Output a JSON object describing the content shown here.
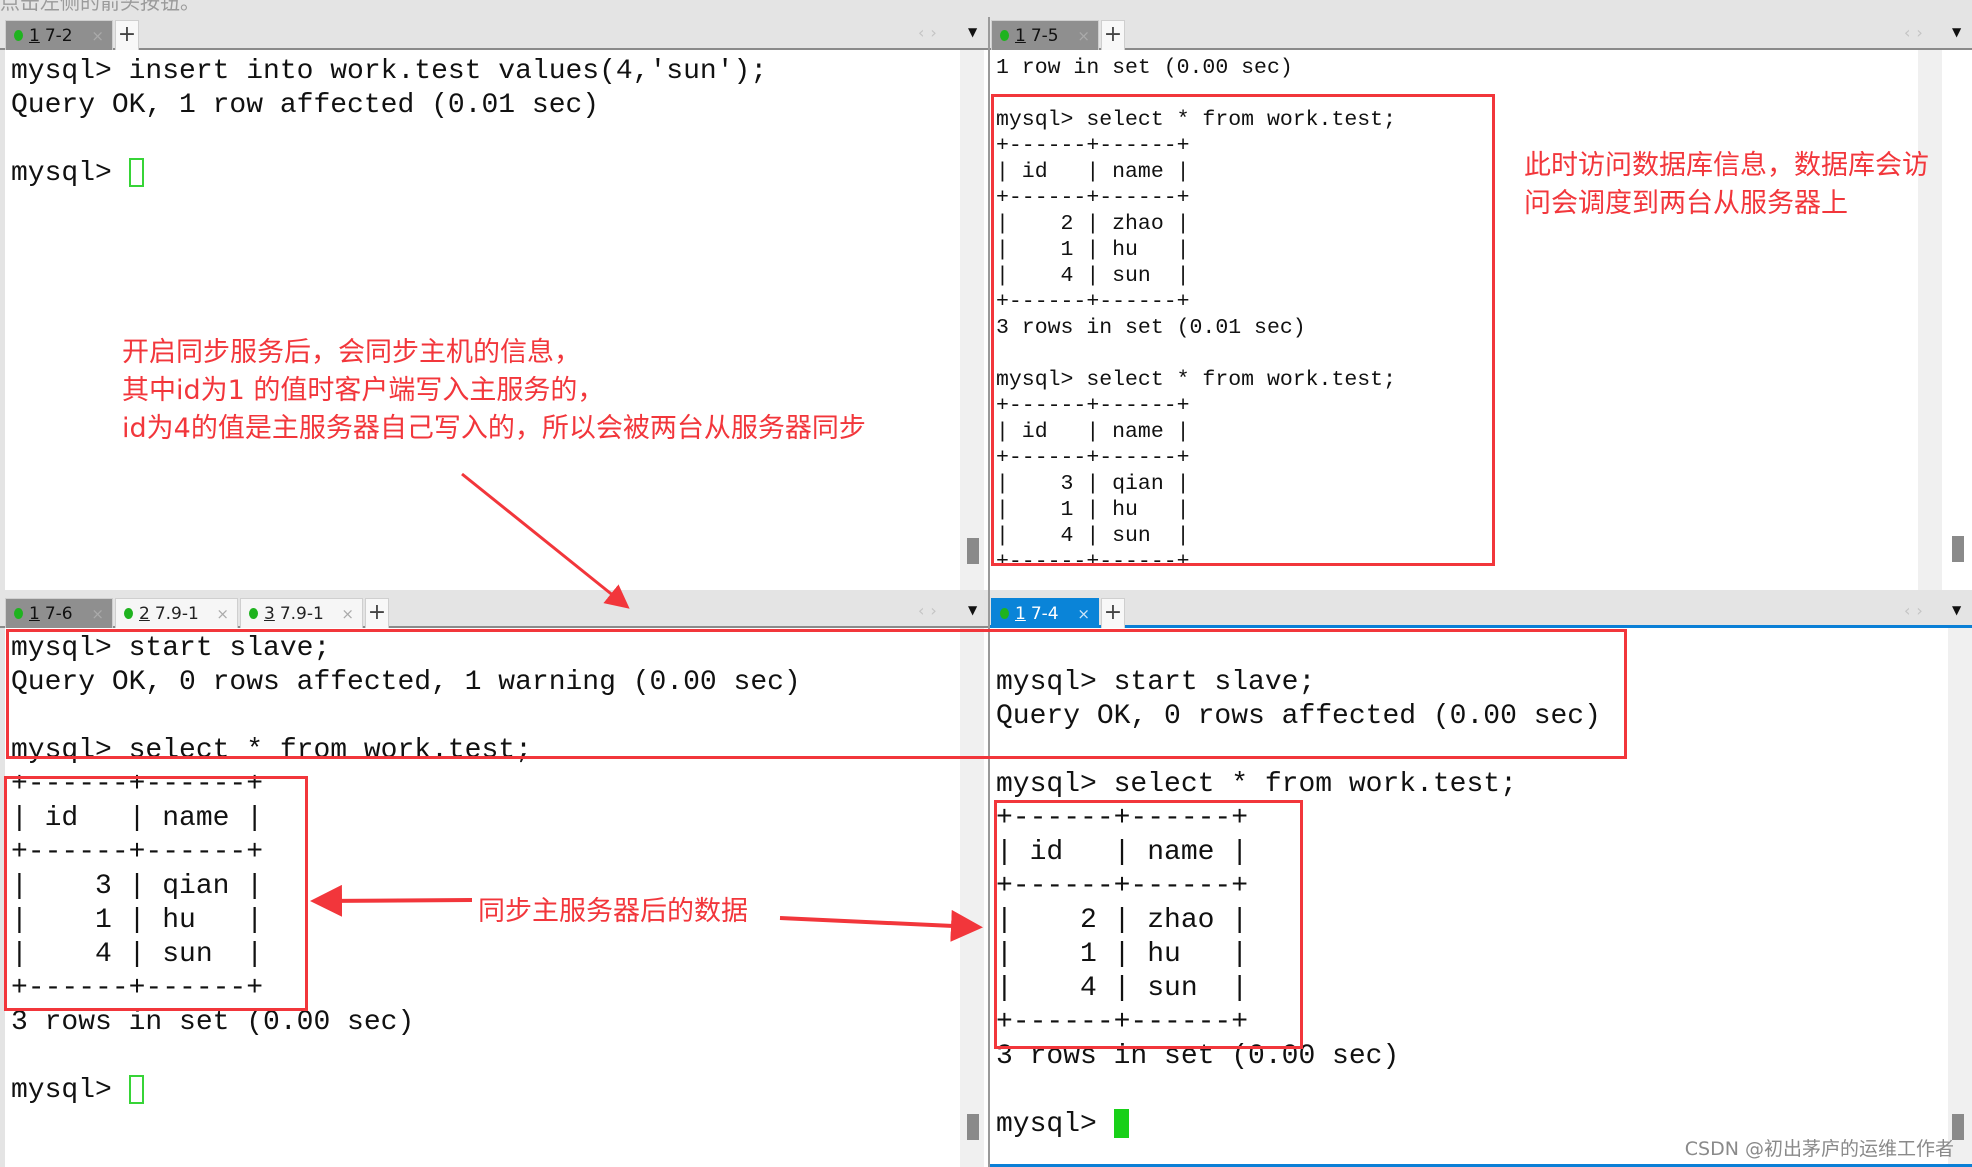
{
  "hint_text": "点击左侧的箭头按钮。",
  "colors": {
    "annotation": "#f2363b",
    "active_tab_blue": "#0a84d8",
    "status_dot": "#1fb31f",
    "cursor": "#37d437"
  },
  "panes": {
    "top_left": {
      "tabs": [
        {
          "num": "1",
          "label": "7-2",
          "state": "active"
        }
      ],
      "lines": [
        "mysql> insert into work.test values(4,'sun');",
        "Query OK, 1 row affected (0.01 sec)",
        "",
        "mysql> "
      ],
      "cursor": "outline"
    },
    "top_right": {
      "tabs": [
        {
          "num": "1",
          "label": "7-5",
          "state": "active"
        }
      ],
      "lines": [
        "1 row in set (0.00 sec)",
        "",
        "mysql> select * from work.test;",
        "+------+------+",
        "| id   | name |",
        "+------+------+",
        "|    2 | zhao |",
        "|    1 | hu   |",
        "|    4 | sun  |",
        "+------+------+",
        "3 rows in set (0.01 sec)",
        "",
        "mysql> select * from work.test;",
        "+------+------+",
        "| id   | name |",
        "+------+------+",
        "|    3 | qian |",
        "|    1 | hu   |",
        "|    4 | sun  |",
        "+------+------+"
      ],
      "cursor": "none"
    },
    "bottom_left": {
      "tabs": [
        {
          "num": "1",
          "label": "7-6",
          "state": "active"
        },
        {
          "num": "2",
          "label": "7.9-1",
          "state": "inactive"
        },
        {
          "num": "3",
          "label": "7.9-1",
          "state": "inactive"
        }
      ],
      "lines": [
        "mysql> start slave;",
        "Query OK, 0 rows affected, 1 warning (0.00 sec)",
        "",
        "mysql> select * from work.test;",
        "+------+------+",
        "| id   | name |",
        "+------+------+",
        "|    3 | qian |",
        "|    1 | hu   |",
        "|    4 | sun  |",
        "+------+------+",
        "3 rows in set (0.00 sec)",
        "",
        "mysql> "
      ],
      "cursor": "outline"
    },
    "bottom_right": {
      "tabs": [
        {
          "num": "1",
          "label": "7-4",
          "state": "active-blue"
        }
      ],
      "lines": [
        "",
        "mysql> start slave;",
        "Query OK, 0 rows affected (0.00 sec)",
        "",
        "mysql> select * from work.test;",
        "+------+------+",
        "| id   | name |",
        "+------+------+",
        "|    2 | zhao |",
        "|    1 | hu   |",
        "|    4 | sun  |",
        "+------+------+",
        "3 rows in set (0.00 sec)",
        "",
        "mysql> "
      ],
      "cursor": "filled"
    }
  },
  "annotations": {
    "slaves_note": "此时访问数据库信息，数据库会访\n问会调度到两台从服务器上",
    "sync_note": "开启同步服务后，会同步主机的信息，\n其中id为1 的值时客户端写入主服务的，\nid为4的值是主服务器自己写入的，所以会被两台从服务器同步",
    "data_note": "同步主服务器后的数据"
  },
  "watermark": "CSDN @初出茅庐的运维工作者"
}
